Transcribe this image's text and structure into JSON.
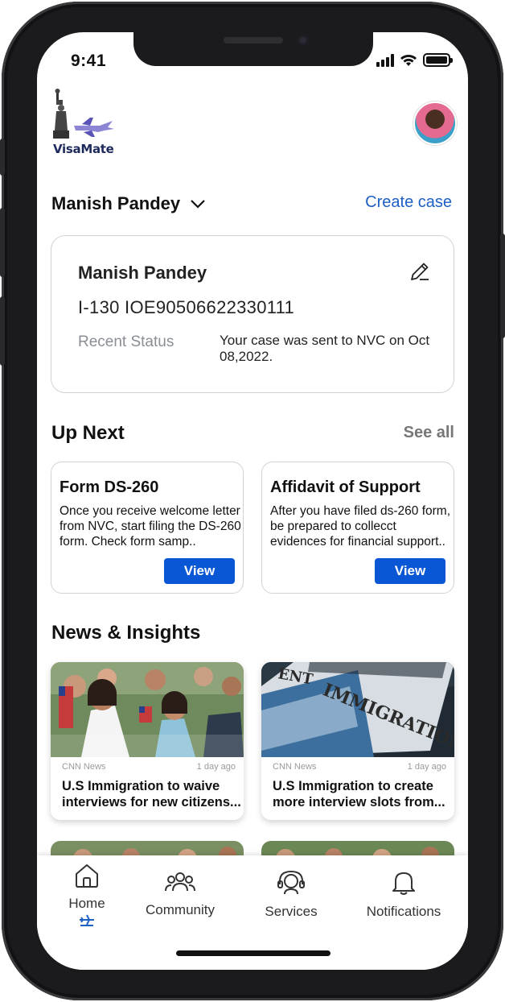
{
  "status_bar": {
    "time": "9:41"
  },
  "header": {
    "logo_text": "VisaMate",
    "create_case_label": "Create case",
    "case_owner": "Manish Pandey"
  },
  "case_card": {
    "name": "Manish Pandey",
    "case_number": "I-130 IOE90506622330111",
    "status_label": "Recent Status",
    "status_text": "Your case was sent to NVC on Oct 08,2022."
  },
  "up_next": {
    "title": "Up Next",
    "see_all": "See all",
    "cards": [
      {
        "title": "Form DS-260",
        "description": "Once you receive welcome letter from NVC, start filing the DS-260 form. Check form samp..",
        "button": "View"
      },
      {
        "title": "Affidavit of Support",
        "description": "After you have filed ds-260 form, be prepared to collecct evidences for financial support..",
        "button": "View"
      }
    ]
  },
  "news": {
    "title": "News & Insights",
    "items": [
      {
        "source": "CNN News",
        "time": "1 day ago",
        "headline_line1": "U.S Immigration to waive",
        "headline_line2": "interviews for new citizens..."
      },
      {
        "source": "CNN News",
        "time": "1 day ago",
        "headline_line1": "U.S Immigration to create",
        "headline_line2": "more interview slots from..."
      }
    ]
  },
  "bottom_nav": {
    "items": [
      {
        "label": "Home",
        "icon": "home-icon",
        "active": true
      },
      {
        "label": "Community",
        "icon": "community-icon"
      },
      {
        "label": "Services",
        "icon": "services-icon"
      },
      {
        "label": "Notifications",
        "icon": "bell-icon"
      }
    ]
  },
  "colors": {
    "accent": "#1e5fc6",
    "button": "#0a57d6",
    "muted": "#8a8f96"
  }
}
